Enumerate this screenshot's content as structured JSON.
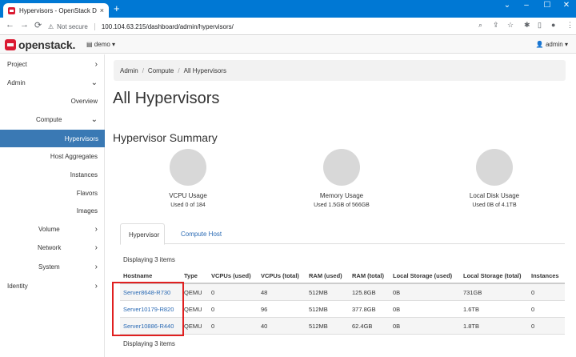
{
  "browser": {
    "tab_title": "Hypervisors - OpenStack Dashb",
    "tab_close": "×",
    "new_tab": "+",
    "nav": {
      "back": "←",
      "forward": "→",
      "reload": "⟳"
    },
    "warning_icon": "⚠",
    "not_secure": "Not secure",
    "url": "100.104.63.215/dashboard/admin/hypervisors/",
    "window_controls": {
      "minimize": "–",
      "maximize": "☐",
      "close": "✕",
      "collapse": "⌄"
    },
    "toolbar_icons": {
      "zoom": "⌕",
      "share": "⇪",
      "bookmark": "☆",
      "extensions": "✱",
      "sidepanel": "▯",
      "profile": "●",
      "menu": "⋮"
    }
  },
  "header": {
    "logo_text": "openstack.",
    "project": "demo ▾",
    "project_icon": "▤",
    "user": "admin ▾",
    "user_icon": "👤"
  },
  "sidebar": {
    "items": [
      {
        "label": "Project",
        "chevron": "›"
      },
      {
        "label": "Admin",
        "chevron": "⌄"
      },
      {
        "label": "Overview"
      },
      {
        "label": "Compute",
        "chevron": "⌄"
      },
      {
        "label": "Hypervisors"
      },
      {
        "label": "Host Aggregates"
      },
      {
        "label": "Instances"
      },
      {
        "label": "Flavors"
      },
      {
        "label": "Images"
      },
      {
        "label": "Volume",
        "chevron": "›"
      },
      {
        "label": "Network",
        "chevron": "›"
      },
      {
        "label": "System",
        "chevron": "›"
      },
      {
        "label": "Identity",
        "chevron": "›"
      }
    ]
  },
  "breadcrumb": {
    "items": [
      "Admin",
      "Compute",
      "All Hypervisors"
    ],
    "separator": "/"
  },
  "page_title": "All Hypervisors",
  "summary": {
    "title": "Hypervisor Summary",
    "usages": [
      {
        "title": "VCPU Usage",
        "sub": "Used 0 of 184"
      },
      {
        "title": "Memory Usage",
        "sub": "Used 1.5GB of 566GB"
      },
      {
        "title": "Local Disk Usage",
        "sub": "Used 0B of 4.1TB"
      }
    ]
  },
  "tabs": [
    "Hypervisor",
    "Compute Host"
  ],
  "display_count": "Displaying 3 items",
  "table": {
    "columns": [
      "Hostname",
      "Type",
      "VCPUs (used)",
      "VCPUs (total)",
      "RAM (used)",
      "RAM (total)",
      "Local Storage (used)",
      "Local Storage (total)",
      "Instances"
    ],
    "rows": [
      [
        "Server8648-R730",
        "QEMU",
        "0",
        "48",
        "512MB",
        "125.8GB",
        "0B",
        "731GB",
        "0"
      ],
      [
        "Server10179-R820",
        "QEMU",
        "0",
        "96",
        "512MB",
        "377.8GB",
        "0B",
        "1.6TB",
        "0"
      ],
      [
        "Server10886-R440",
        "QEMU",
        "0",
        "40",
        "512MB",
        "62.4GB",
        "0B",
        "1.8TB",
        "0"
      ]
    ]
  },
  "colors": {
    "brand": "#da1a32",
    "chrome": "#0078d4",
    "active_nav": "#3a79b4",
    "link": "#2a6ab4",
    "highlight": "#e02020"
  }
}
